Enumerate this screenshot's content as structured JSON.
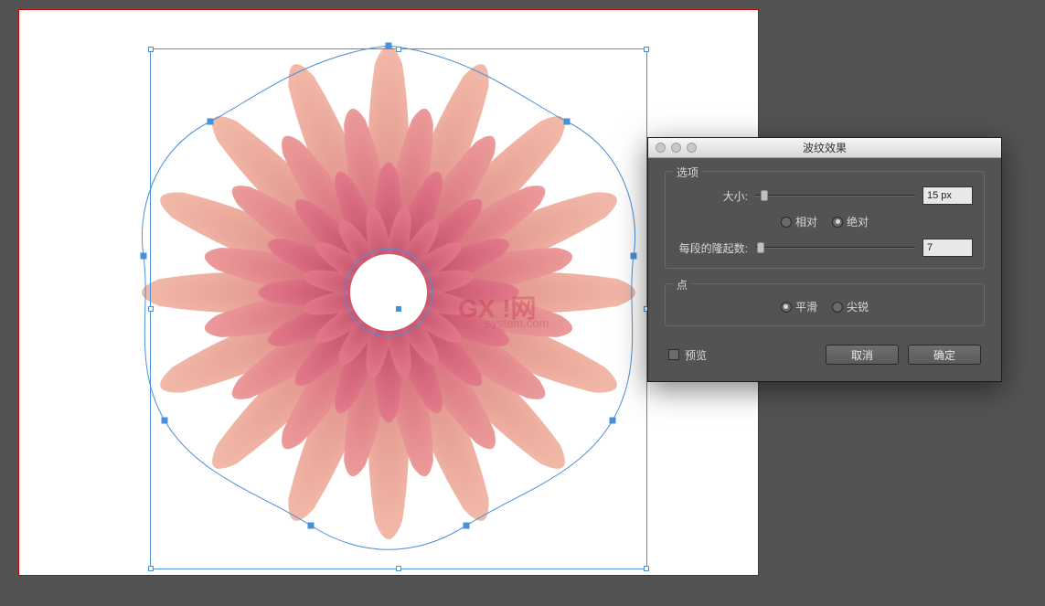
{
  "dialog": {
    "title": "波纹效果",
    "options_group": "选项",
    "size_label": "大小:",
    "size_value": "15 px",
    "relative_label": "相对",
    "absolute_label": "绝对",
    "ridges_label": "每段的隆起数:",
    "ridges_value": "7",
    "points_group": "点",
    "smooth_label": "平滑",
    "sharp_label": "尖锐",
    "preview_label": "预览",
    "cancel_label": "取消",
    "ok_label": "确定"
  },
  "watermark": {
    "main": "GX !网",
    "sub": "system.com"
  },
  "flower": {
    "colors": {
      "outer_light": "#f2b9a8",
      "outer_dark": "#d67b7a",
      "mid_light": "#ec9a9a",
      "mid_dark": "#c85a6a",
      "inner_light": "#e27a8a",
      "inner_dark": "#b53a5a"
    }
  }
}
